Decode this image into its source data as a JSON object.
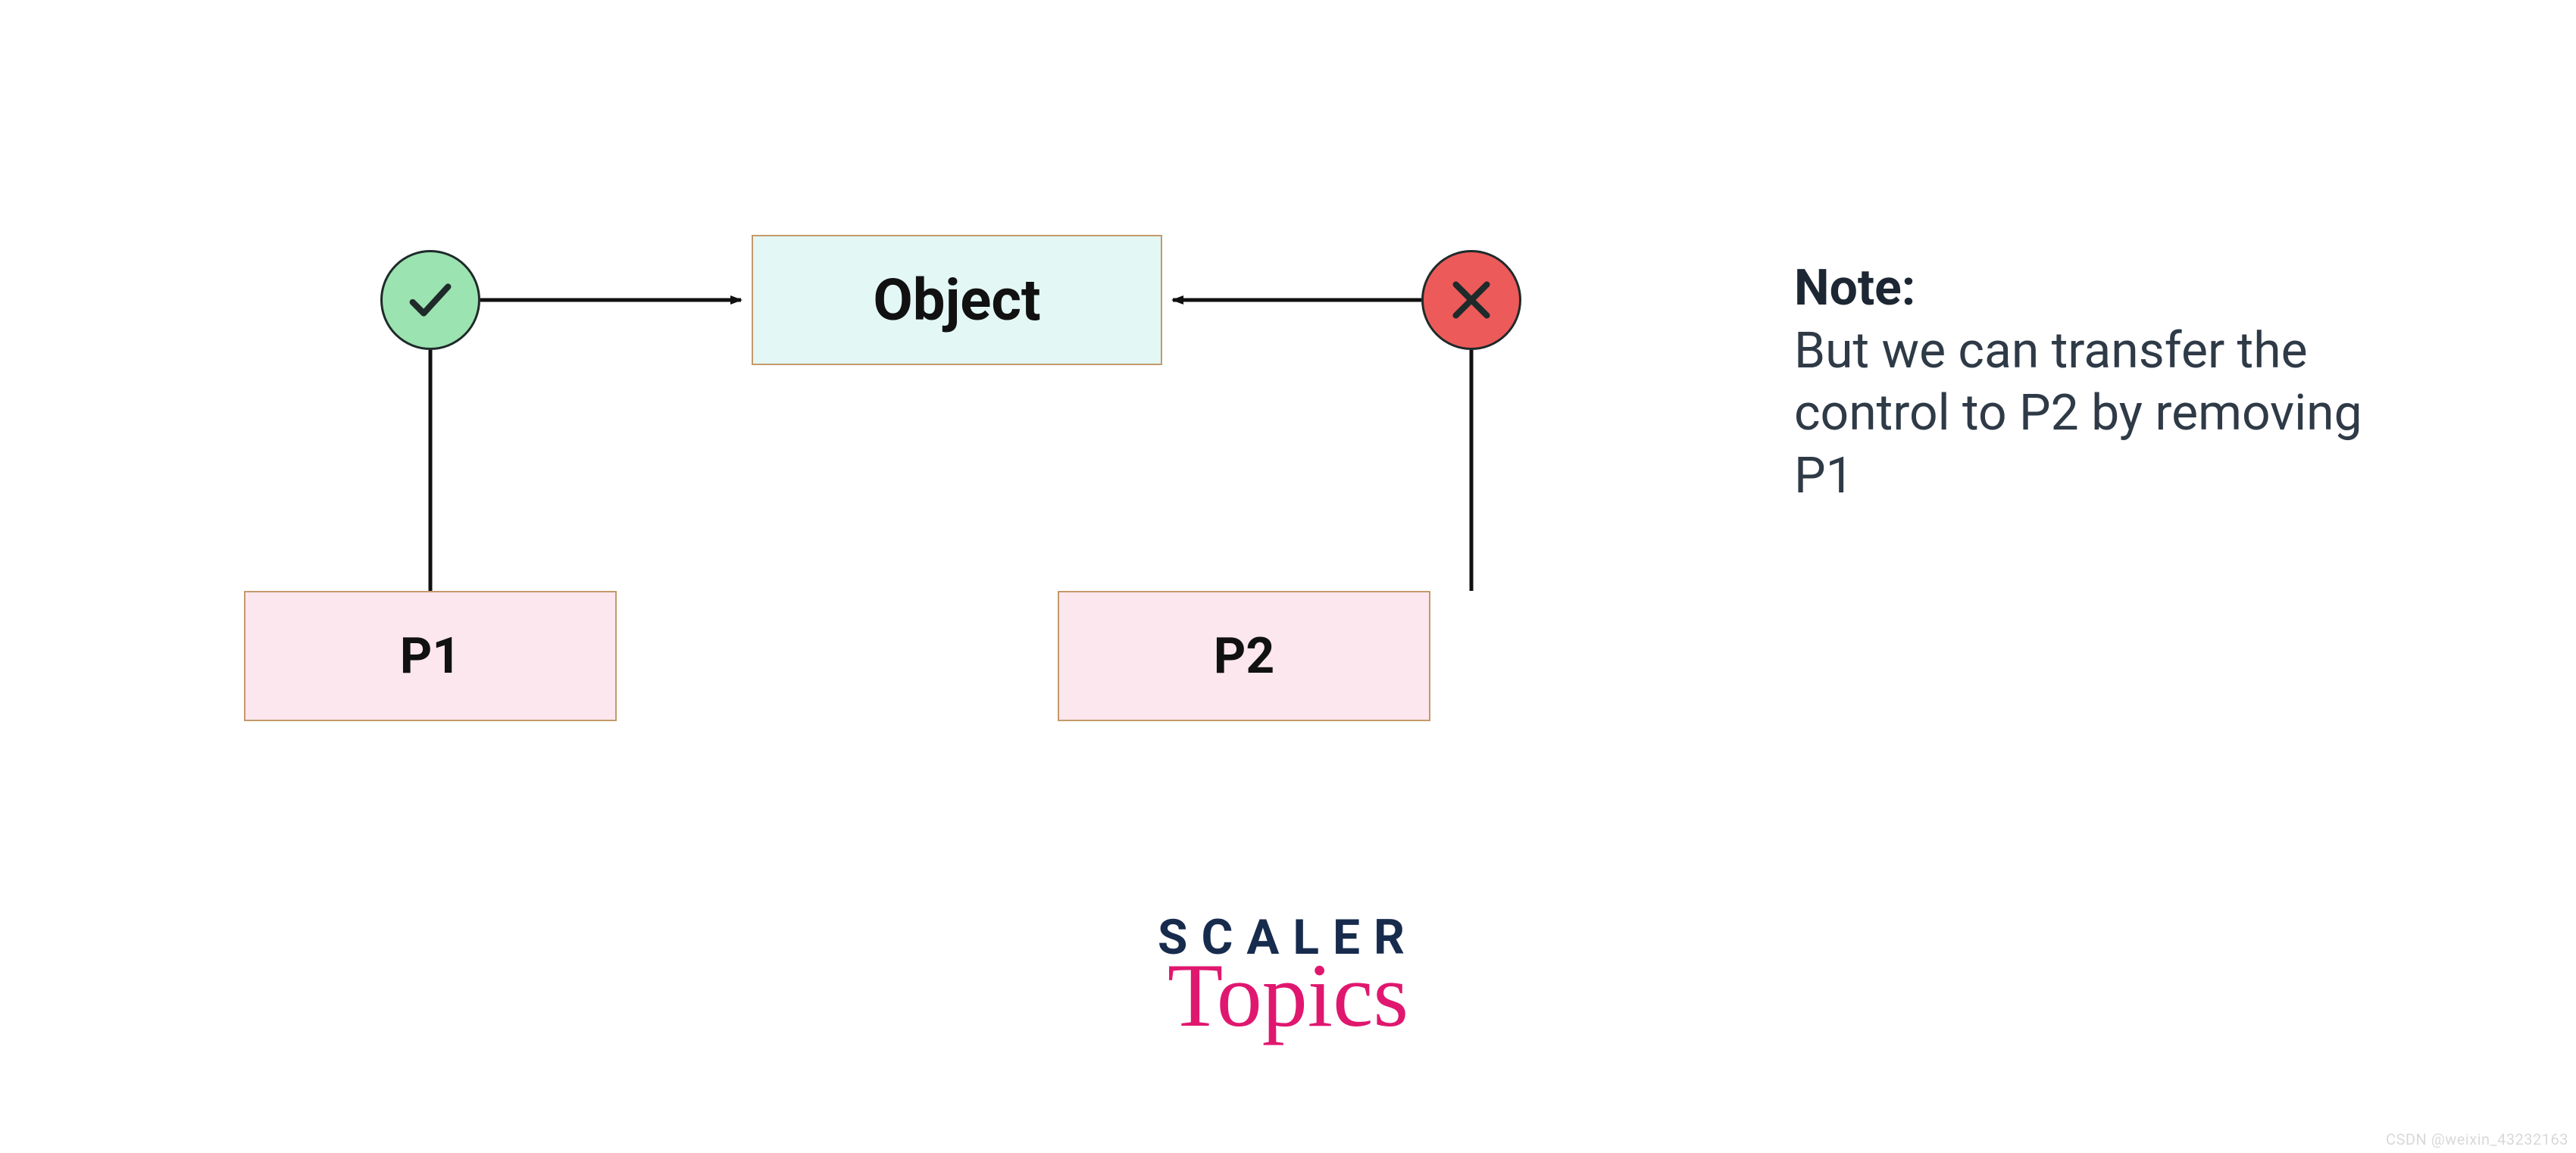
{
  "diagram": {
    "object_label": "Object",
    "p1_label": "P1",
    "p2_label": "P2",
    "check_icon": "checkmark",
    "cross_icon": "cross"
  },
  "note": {
    "title": "Note:",
    "body": "But we can transfer the control to P2 by removing P1"
  },
  "branding": {
    "line1": "SCALER",
    "line2": "Topics"
  },
  "watermark": "CSDN @weixin_43232163",
  "colors": {
    "object_bg": "#e3f7f5",
    "p_bg": "#fce7ee",
    "box_border": "#c39a6b",
    "check_bg": "#9be3b0",
    "cross_bg": "#ec5a5a",
    "note_text": "#2f3a47",
    "scaler_text": "#172b4d",
    "topics_text": "#e0176f"
  }
}
